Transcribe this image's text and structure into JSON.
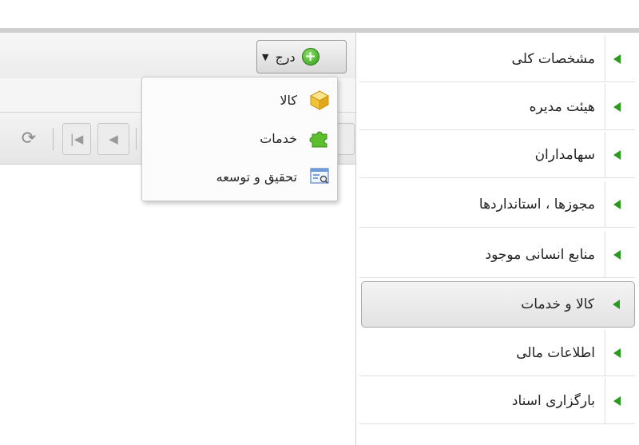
{
  "toolbar": {
    "insert_label": "درج",
    "insert_icon": "add-circle-icon",
    "dropdown_icon": "caret-down-icon"
  },
  "pager": {
    "refresh_icon": "refresh-icon",
    "first_icon": "first-page-icon",
    "prev_icon": "previous-page-icon"
  },
  "insert_menu": {
    "items": [
      {
        "label": "کالا",
        "icon": "package-icon"
      },
      {
        "label": "خدمات",
        "icon": "puzzle-icon"
      },
      {
        "label": "تحقیق و توسعه",
        "icon": "form-search-icon"
      }
    ]
  },
  "sidebar": {
    "items": [
      {
        "label": "مشخصات کلی"
      },
      {
        "label": "هیئت مدیره"
      },
      {
        "label": "سهامداران"
      },
      {
        "label": "مجوزها ، استانداردها"
      },
      {
        "label": "منابع انسانی موجود"
      },
      {
        "label": "کالا و خدمات",
        "active": true
      },
      {
        "label": "اطلاعات مالی"
      },
      {
        "label": "بارگزاری اسناد"
      }
    ]
  },
  "colors": {
    "accent_green": "#2a9a1e",
    "border": "#c9c9c9"
  }
}
